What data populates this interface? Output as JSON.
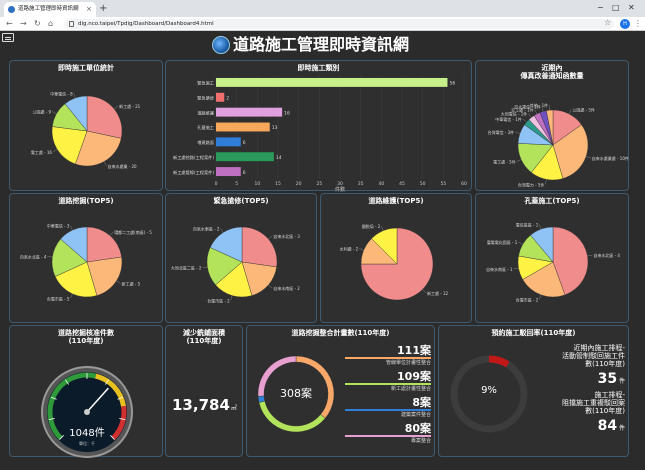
{
  "browser": {
    "tab_title": "道路施工管理即時資訊網",
    "tab_close": "×",
    "new_tab": "+",
    "url": "dig.nco.taipei/Tpdig/Dashboard/Dashboard4.html",
    "profile": "H"
  },
  "page": {
    "title": "道路施工管理即時資訊網"
  },
  "panels": {
    "unit_stats": {
      "title": "即時施工單位統計"
    },
    "category": {
      "title": "即時施工類別",
      "xlabel": "件數"
    },
    "nearby": {
      "title": "近期內\n傳真改善通知函數量"
    },
    "dig": {
      "title": "道路挖掘(TOP5)"
    },
    "emergency": {
      "title": "緊急搶修(TOP5)"
    },
    "maintenance": {
      "title": "道路維護(TOP5)"
    },
    "conduit": {
      "title": "孔蓋施工(TOP5)"
    },
    "gauge": {
      "title": "道路挖掘核准件數\n(110年度)",
      "value": "1048件",
      "unit": "單位：千"
    },
    "reduce": {
      "title": "減少銑鋪面積\n(110年度)",
      "value": "13,784",
      "unit": "㎡"
    },
    "plan": {
      "title": "道路挖掘整合計畫數(110年度)",
      "total": "308案",
      "items": [
        {
          "value": "111案",
          "label": "管線單位計畫性整合",
          "color": "#f9a86a"
        },
        {
          "value": "109案",
          "label": "新工處計畫性整合",
          "color": "#b2e35a"
        },
        {
          "value": "8案",
          "label": "建築案件整合",
          "color": "#2f7fd8"
        },
        {
          "value": "80案",
          "label": "專案整合",
          "color": "#e8a0d0"
        }
      ]
    },
    "reply": {
      "title": "預約施工駁回率(110年度)",
      "percent": "9%",
      "lines": [
        {
          "label": "近期內施工排程-\n活動管制駁回施工件\n數(110年度)",
          "value": "35",
          "unit": "件"
        },
        {
          "label": "施工排程-\n阻擋施工重複駁回案\n數(110年度)",
          "value": "84",
          "unit": "件"
        }
      ]
    }
  },
  "chart_data": [
    {
      "id": "unit",
      "type": "pie",
      "title": "即時施工單位統計",
      "slices": [
        {
          "label": "新工處 - 21",
          "value": 21,
          "color": "#f08c8c"
        },
        {
          "label": "自來水處業 - 20",
          "value": 20,
          "color": "#fbb878"
        },
        {
          "label": "電工處 - 16",
          "value": 16,
          "color": "#fef244"
        },
        {
          "label": "公園處 - 9",
          "value": 9,
          "color": "#b2e35a"
        },
        {
          "label": "中華電信 - 8",
          "value": 8,
          "color": "#8fc3f5"
        }
      ]
    },
    {
      "id": "category",
      "type": "bar",
      "title": "即時施工類別",
      "xlabel": "件數",
      "xlim": [
        0,
        60
      ],
      "xticks": [
        0,
        5,
        10,
        15,
        20,
        25,
        30,
        35,
        40,
        45,
        50,
        55,
        60
      ],
      "bars": [
        {
          "label": "緊急施工",
          "value": 56,
          "color": "#c7f08a"
        },
        {
          "label": "緊急搶修",
          "value": 2,
          "color": "#f07070"
        },
        {
          "label": "道路維護",
          "value": 16,
          "color": "#e0a0e0"
        },
        {
          "label": "孔蓋施工",
          "value": 13,
          "color": "#f7a85a"
        },
        {
          "label": "增建路面",
          "value": 6,
          "color": "#2f7fd8"
        },
        {
          "label": "新工處挖路(工程案件)",
          "value": 14,
          "color": "#2a9a5a"
        },
        {
          "label": "新工處管線(工程案件)",
          "value": 6,
          "color": "#c070c0"
        }
      ]
    },
    {
      "id": "nearby",
      "type": "pie",
      "title": "近期內傳真改善通知函數量",
      "slices": [
        {
          "label": "公園處 - 5件",
          "value": 5,
          "color": "#f08c8c"
        },
        {
          "label": "自來水處業處 - 10件",
          "value": 10,
          "color": "#fbb878"
        },
        {
          "label": "台灣電力 - 5件",
          "value": 5,
          "color": "#fef244"
        },
        {
          "label": "電工處 - 5件",
          "value": 5,
          "color": "#b2e35a"
        },
        {
          "label": "台灣電信 - 3件",
          "value": 3,
          "color": "#8fc3f5"
        },
        {
          "label": "中華電信 - 1件",
          "value": 1,
          "color": "#2a9a8a"
        },
        {
          "label": "大同電信 - 1件",
          "value": 1,
          "color": "#f0c0e0"
        },
        {
          "label": "交工處 - 1件",
          "value": 1,
          "color": "#c070c0"
        },
        {
          "label": "亞太電信 - 1件",
          "value": 1,
          "color": "#7050c0"
        },
        {
          "label": "其他 - 1件",
          "value": 1,
          "color": "#fbb878"
        }
      ]
    },
    {
      "id": "dig",
      "type": "pie",
      "title": "道路挖掘(TOP5)",
      "slices": [
        {
          "label": "環都二工處(南區) - 5",
          "value": 5,
          "color": "#f08c8c"
        },
        {
          "label": "新工處 - 5",
          "value": 5,
          "color": "#fbb878"
        },
        {
          "label": "台電市區 - 5",
          "value": 5,
          "color": "#fef244"
        },
        {
          "label": "自來水北區 - 4",
          "value": 4,
          "color": "#b2e35a"
        },
        {
          "label": "中華電信 - 3",
          "value": 3,
          "color": "#8fc3f5"
        }
      ]
    },
    {
      "id": "emergency",
      "type": "pie",
      "title": "緊急搶修(TOP5)",
      "slices": [
        {
          "label": "自來水北區 - 3",
          "value": 3,
          "color": "#f08c8c"
        },
        {
          "label": "自來水南區 - 2",
          "value": 2,
          "color": "#fbb878"
        },
        {
          "label": "台電市區 - 2",
          "value": 2,
          "color": "#fef244"
        },
        {
          "label": "大同北區二區 - 2",
          "value": 2,
          "color": "#b2e35a"
        },
        {
          "label": "自來水東區 - 2",
          "value": 2,
          "color": "#8fc3f5"
        }
      ]
    },
    {
      "id": "maintenance",
      "type": "pie",
      "title": "道路維護(TOP5)",
      "slices": [
        {
          "label": "新工處 - 12",
          "value": 12,
          "color": "#f08c8c"
        },
        {
          "label": "水利處 - 2",
          "value": 2,
          "color": "#fbb878"
        },
        {
          "label": "國稅局 - 2",
          "value": 2,
          "color": "#fef244"
        }
      ]
    },
    {
      "id": "conduit",
      "type": "pie",
      "title": "孔蓋施工(TOP5)",
      "slices": [
        {
          "label": "自來水北區 - 4",
          "value": 4,
          "color": "#f08c8c"
        },
        {
          "label": "台電市區 - 2",
          "value": 2,
          "color": "#fbb878"
        },
        {
          "label": "自來水南區 - 1",
          "value": 1,
          "color": "#fef244"
        },
        {
          "label": "臺電電化園區 - 1",
          "value": 1,
          "color": "#b2e35a"
        },
        {
          "label": "電信區區 - 1",
          "value": 1,
          "color": "#8fc3f5"
        }
      ]
    },
    {
      "id": "gauge",
      "type": "gauge",
      "value": 1048,
      "min": 0,
      "max": 1600,
      "ticks": [
        0,
        200,
        400,
        600,
        800,
        1000,
        1200,
        1400,
        1600
      ]
    },
    {
      "id": "plan",
      "type": "donut",
      "slices": [
        {
          "label": "管線單位計畫性整合",
          "value": 111,
          "color": "#f9a86a"
        },
        {
          "label": "新工處計畫性整合",
          "value": 109,
          "color": "#b2e35a"
        },
        {
          "label": "建築案件整合",
          "value": 8,
          "color": "#2f7fd8"
        },
        {
          "label": "專案整合",
          "value": 80,
          "color": "#e8a0d0"
        }
      ]
    },
    {
      "id": "reply",
      "type": "donut",
      "value": 9,
      "max": 100
    }
  ]
}
